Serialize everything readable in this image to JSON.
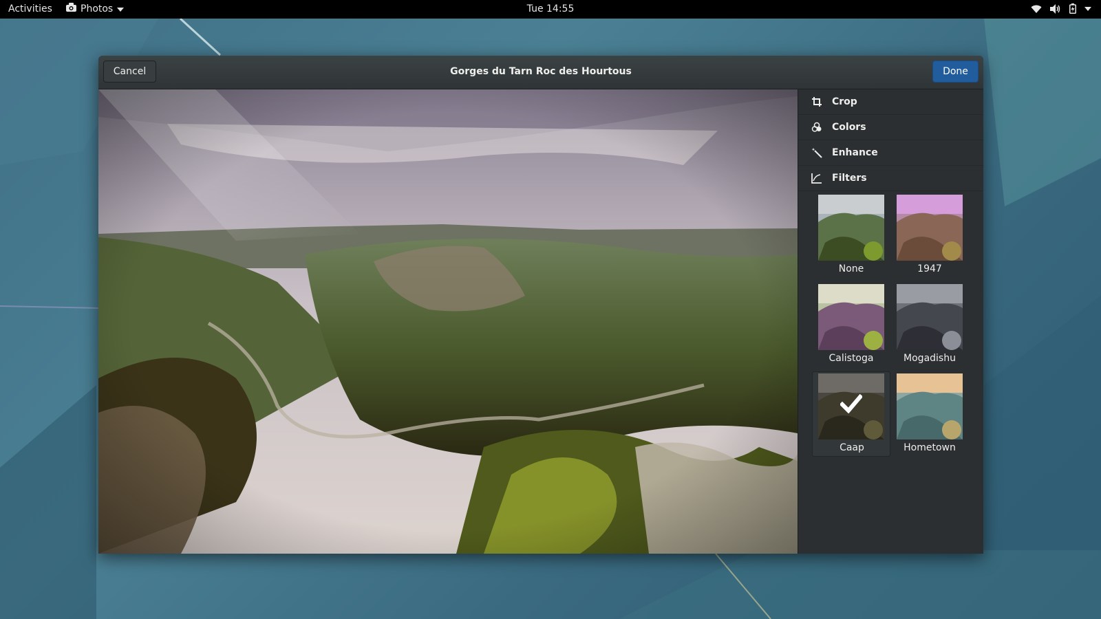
{
  "topbar": {
    "activities": "Activities",
    "app_name": "Photos",
    "clock": "Tue 14:55",
    "tray_icons": [
      "wifi-icon",
      "volume-icon",
      "battery-icon",
      "chevron-down-icon"
    ]
  },
  "window": {
    "title": "Gorges du Tarn Roc des Hourtous",
    "cancel_label": "Cancel",
    "done_label": "Done",
    "accent_color": "#215d9c"
  },
  "tools": [
    {
      "label": "Crop",
      "icon": "crop-icon"
    },
    {
      "label": "Colors",
      "icon": "colors-icon"
    },
    {
      "label": "Enhance",
      "icon": "enhance-icon"
    },
    {
      "label": "Filters",
      "icon": "filters-icon"
    }
  ],
  "filters": [
    {
      "label": "None",
      "selected": false,
      "tint": "#9ab0b8"
    },
    {
      "label": "1947",
      "selected": false,
      "tint": "#c77fcf"
    },
    {
      "label": "Calistoga",
      "selected": false,
      "tint": "#b7c7a0"
    },
    {
      "label": "Mogadishu",
      "selected": false,
      "tint": "#6d6f78"
    },
    {
      "label": "Caap",
      "selected": true,
      "tint": "#4e4a42"
    },
    {
      "label": "Hometown",
      "selected": false,
      "tint": "#e2b98a"
    }
  ]
}
